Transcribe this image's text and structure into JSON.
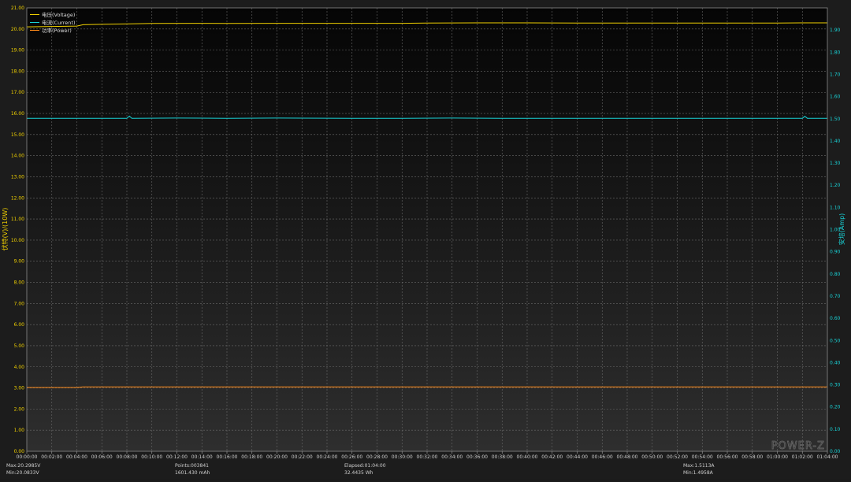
{
  "chart_data": {
    "type": "line",
    "left_axis": {
      "label": "伏特(V)/(10W)",
      "ylim": [
        0,
        21
      ],
      "ticks": [
        "0.00",
        "1.00",
        "2.00",
        "3.00",
        "4.00",
        "5.00",
        "6.00",
        "7.00",
        "8.00",
        "9.00",
        "10.00",
        "11.00",
        "12.00",
        "13.00",
        "14.00",
        "15.00",
        "16.00",
        "17.00",
        "18.00",
        "19.00",
        "20.00",
        "21.00"
      ],
      "color": "#f0d000"
    },
    "right_axis": {
      "label": "安培(Amp)",
      "ylim": [
        0,
        2.0
      ],
      "ticks": [
        "0.00",
        "0.10",
        "0.20",
        "0.30",
        "0.40",
        "0.50",
        "0.60",
        "0.70",
        "0.80",
        "0.90",
        "1.00",
        "1.10",
        "1.20",
        "1.30",
        "1.40",
        "1.50",
        "1.60",
        "1.70",
        "1.80",
        "1.90"
      ],
      "color": "#19d2d6"
    },
    "x_axis": {
      "unit": "elapsed hh:mm:ss",
      "xlim_minutes": [
        0,
        64
      ],
      "tick_labels": [
        "00:00:00",
        "00:02:00",
        "00:04:00",
        "00:06:00",
        "00:08:00",
        "00:10:00",
        "00:12:00",
        "00:14:00",
        "00:16:00",
        "00:18:00",
        "00:20:00",
        "00:22:00",
        "00:24:00",
        "00:26:00",
        "00:28:00",
        "00:30:00",
        "00:32:00",
        "00:34:00",
        "00:36:00",
        "00:38:00",
        "00:40:00",
        "00:42:00",
        "00:44:00",
        "00:46:00",
        "00:48:00",
        "00:50:00",
        "00:52:00",
        "00:54:00",
        "00:56:00",
        "00:58:00",
        "01:00:00",
        "01:02:00",
        "01:04:00"
      ]
    },
    "grid": true,
    "legend_position": "top-left",
    "series": [
      {
        "name": "电压(Voltage)",
        "axis": "left",
        "color": "#f0d000",
        "x_minutes": [
          0,
          2,
          4,
          4.5,
          6,
          8,
          10,
          14,
          16,
          20,
          24,
          30,
          32,
          36,
          40,
          44,
          48,
          52,
          56,
          60,
          62,
          64
        ],
        "y": [
          20.1,
          20.12,
          20.14,
          20.2,
          20.22,
          20.24,
          20.26,
          20.27,
          20.26,
          20.27,
          20.27,
          20.27,
          20.28,
          20.29,
          20.29,
          20.28,
          20.28,
          20.28,
          20.28,
          20.28,
          20.29,
          20.29
        ]
      },
      {
        "name": "电流(Current)",
        "axis": "right",
        "color": "#19d2d6",
        "x_minutes": [
          0,
          4,
          8,
          8.2,
          8.4,
          12,
          16,
          20,
          26,
          30,
          34,
          38,
          42,
          46,
          50,
          54,
          58,
          62,
          62.2,
          62.4,
          64
        ],
        "y": [
          1.502,
          1.502,
          1.502,
          1.512,
          1.502,
          1.503,
          1.502,
          1.503,
          1.502,
          1.502,
          1.503,
          1.502,
          1.502,
          1.502,
          1.502,
          1.502,
          1.502,
          1.502,
          1.511,
          1.502,
          1.502
        ]
      },
      {
        "name": "功率(Power)",
        "axis": "left",
        "color": "#ff8c1a",
        "x_minutes": [
          0,
          4,
          4.5,
          8,
          16,
          24,
          32,
          40,
          48,
          56,
          64
        ],
        "y": [
          3.02,
          3.02,
          3.05,
          3.05,
          3.05,
          3.05,
          3.05,
          3.05,
          3.05,
          3.05,
          3.05
        ]
      }
    ]
  },
  "stats": {
    "voltage_max": "Max:20.2985V",
    "voltage_min": "Min:20.0833V",
    "points": "Points:003841",
    "capacity": "1601.430 mAh",
    "elapsed": "Elapsed:01:04:00",
    "energy": "32.4435 Wh",
    "current_max": "Max:1.5113A",
    "current_min": "Min:1.4958A"
  },
  "watermark": "POWER-Z"
}
